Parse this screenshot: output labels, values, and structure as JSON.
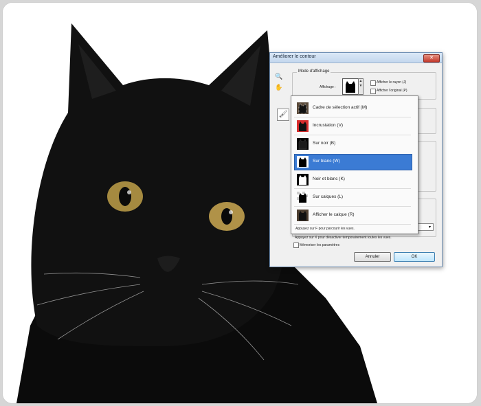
{
  "dialog": {
    "title": "Améliorer le contour",
    "close_glyph": "✕",
    "view_mode": {
      "group_title": "Mode d'affichage",
      "view_label": "Affichage :",
      "show_radius_label": "Afficher le rayon (J)",
      "show_original_label": "Afficher l'original (P)"
    },
    "views": [
      {
        "label": "Cadre de sélection actif (M)",
        "icon": "marching-ants-thumb"
      },
      {
        "label": "Incrustation (V)",
        "icon": "red-overlay-thumb"
      },
      {
        "label": "Sur noir (B)",
        "icon": "on-black-thumb"
      },
      {
        "label": "Sur blanc (W)",
        "icon": "on-white-thumb",
        "selected": true
      },
      {
        "label": "Noir et blanc (K)",
        "icon": "black-white-thumb"
      },
      {
        "label": "Sur calques (L)",
        "icon": "on-layers-thumb"
      },
      {
        "label": "Afficher le calque (R)",
        "icon": "reveal-layer-thumb"
      }
    ],
    "hint_cycle": "Appuyez sur F pour parcourir les vues.",
    "hint_disable": "Appuyez sur X pour désactiver temporairement toutes les vues.",
    "remember_label": "Mémoriser les paramètres",
    "cancel_label": "Annuler",
    "ok_label": "OK",
    "combo_arrow": "▾",
    "tool_icons": {
      "zoom": "🔍",
      "hand": "✋",
      "brush": "🖌"
    },
    "colors": {
      "selection": "#3b7bd4",
      "titlebar": "#c3d7ee",
      "overlay_red": "#d82c2c"
    }
  }
}
